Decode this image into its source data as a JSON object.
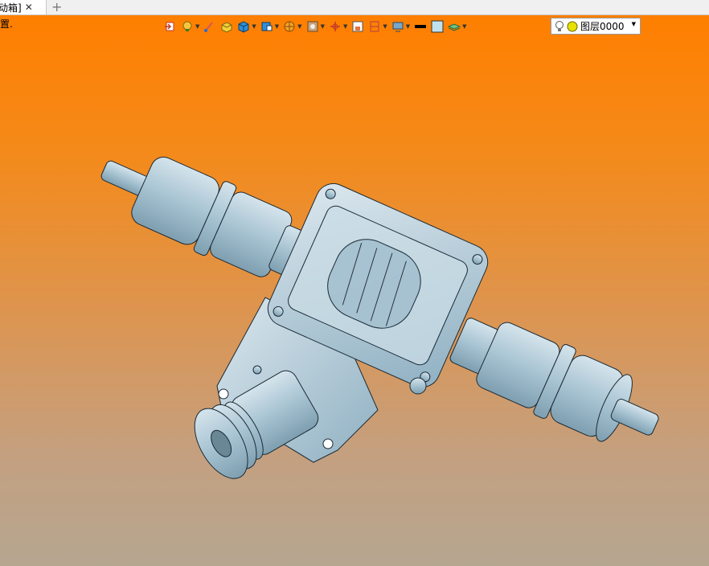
{
  "tab": {
    "label": "动箱]",
    "close": "✕",
    "add": "+"
  },
  "prompt_text": "置.",
  "toolbar": {
    "icons": [
      "exit-icon",
      "light-bulb-icon",
      "brush-icon",
      "box-edit-icon",
      "cube-icon",
      "cube-view-icon",
      "sphere-icon",
      "render-icon",
      "axis-icon",
      "section-icon",
      "clip-icon",
      "display-icon",
      "line-color-icon",
      "fill-color-icon",
      "layer-stack-icon"
    ]
  },
  "layer": {
    "name": "图层0000"
  },
  "colors": {
    "accent": "#ff7f00",
    "model": "#a9c6d6"
  }
}
